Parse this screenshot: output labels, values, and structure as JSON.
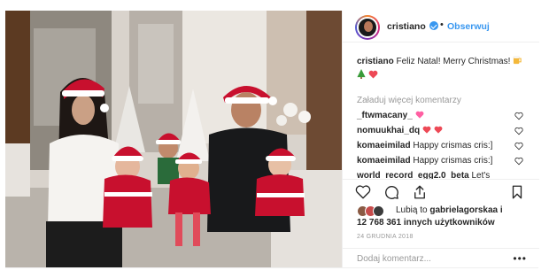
{
  "post": {
    "username": "cristiano",
    "follow_label": "Obserwuj",
    "separator": "•",
    "caption_text": "Feliz Natal! Merry Christmas!",
    "load_more": "Załaduj więcej komentarzy",
    "comments": [
      {
        "user": "_ftwmacany_",
        "text": "",
        "emoji": "heart-pink"
      },
      {
        "user": "nomuukhai_dq",
        "text": "",
        "emoji": "hearts-red"
      },
      {
        "user": "komaeimilad",
        "text": "Happy crismas cris:]"
      },
      {
        "user": "komaeimilad",
        "text": "Happy crismas cris:]"
      }
    ],
    "wrapped_comment": {
      "user": "world_record_egg2.0_beta",
      "text": "Let's make a couple of eggs conquer the"
    },
    "likes_line1_prefix": "Lubią to",
    "likes_line1_user": "gabrielagorskaa i",
    "likes_line2": "12 768 361 innych użytkowników",
    "date": "24 GRUDNIA 2018",
    "add_comment_placeholder": "Dodaj komentarz...",
    "more_label": "•••"
  },
  "icons": {
    "verified": "verified-badge-icon",
    "heart": "heart-icon",
    "comment": "comment-icon",
    "share": "share-icon",
    "bookmark": "bookmark-icon"
  },
  "colors": {
    "link_blue": "#3897f0",
    "muted": "#999999",
    "text": "#262626",
    "heart_red": "#ed4956"
  }
}
